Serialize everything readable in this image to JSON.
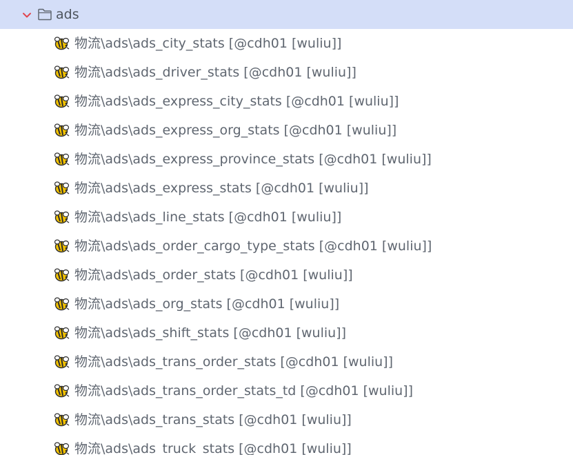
{
  "tree": {
    "folder": {
      "label": "ads",
      "expanded": true,
      "chevron_icon": "chevron-down-icon",
      "folder_icon": "folder-icon"
    },
    "item_icon": "hive-bee-icon",
    "items": [
      {
        "label": "物流\\ads\\ads_city_stats [@cdh01 [wuliu]]"
      },
      {
        "label": "物流\\ads\\ads_driver_stats [@cdh01 [wuliu]]"
      },
      {
        "label": "物流\\ads\\ads_express_city_stats [@cdh01 [wuliu]]"
      },
      {
        "label": "物流\\ads\\ads_express_org_stats [@cdh01 [wuliu]]"
      },
      {
        "label": "物流\\ads\\ads_express_province_stats [@cdh01 [wuliu]]"
      },
      {
        "label": "物流\\ads\\ads_express_stats [@cdh01 [wuliu]]"
      },
      {
        "label": "物流\\ads\\ads_line_stats [@cdh01 [wuliu]]"
      },
      {
        "label": "物流\\ads\\ads_order_cargo_type_stats [@cdh01 [wuliu]]"
      },
      {
        "label": "物流\\ads\\ads_order_stats [@cdh01 [wuliu]]"
      },
      {
        "label": "物流\\ads\\ads_org_stats [@cdh01 [wuliu]]"
      },
      {
        "label": "物流\\ads\\ads_shift_stats [@cdh01 [wuliu]]"
      },
      {
        "label": "物流\\ads\\ads_trans_order_stats [@cdh01 [wuliu]]"
      },
      {
        "label": "物流\\ads\\ads_trans_order_stats_td [@cdh01 [wuliu]]"
      },
      {
        "label": "物流\\ads\\ads_trans_stats [@cdh01 [wuliu]]"
      },
      {
        "label": "物流\\ads\\ads_truck_stats [@cdh01 [wuliu]]"
      }
    ],
    "colors": {
      "selected_row_bg": "#d4def8",
      "chevron": "#e0464f",
      "text": "#5f6670",
      "icon_yellow": "#f5c400",
      "icon_dark": "#2d2d2d"
    }
  }
}
